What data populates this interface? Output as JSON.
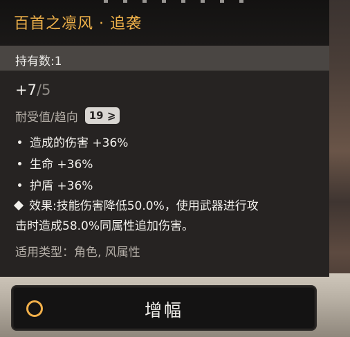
{
  "card": {
    "title": "百首之凛风 · 追袭",
    "count_label": "持有数:1",
    "level_current": "+7",
    "level_sep": "/",
    "level_max": "5",
    "preference_label": "耐受值/趋向",
    "preference_badge": "19 ⩾",
    "stats": [
      {
        "label": "造成的伤害 +36%"
      },
      {
        "label": "生命 +36%"
      },
      {
        "label": "护盾 +36%"
      }
    ],
    "effect_line1": "效果:技能伤害降低50.0%，使用武器进行攻",
    "effect_line2": "击时造成58.0%同属性追加伤害。",
    "applicable": "适用类型：角色, 风属性"
  },
  "action": {
    "button_label": "增幅"
  },
  "colors": {
    "accent": "#f0b24a",
    "panel": "#262322",
    "count_bar": "#4a4643"
  },
  "icons": {
    "button_icon": "circle-icon",
    "effect_bullet": "diamond-icon"
  }
}
